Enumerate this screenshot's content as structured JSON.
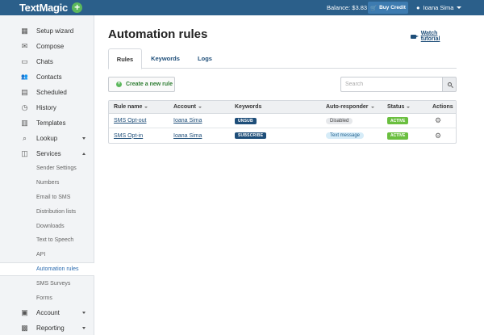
{
  "topbar": {
    "logo": "TextMagic",
    "logo_plus": "+",
    "balance": "Balance: $3.83",
    "buy_credit": "Buy Credit",
    "user_name": "Ioana Sima"
  },
  "sidebar": {
    "items": [
      {
        "label": "Setup wizard",
        "icon": "grid-icon",
        "glyph": "▦"
      },
      {
        "label": "Compose",
        "icon": "envelope-icon",
        "glyph": "✉"
      },
      {
        "label": "Chats",
        "icon": "chat-icon",
        "glyph": "▭"
      },
      {
        "label": "Contacts",
        "icon": "people-icon",
        "glyph": "👥"
      },
      {
        "label": "Scheduled",
        "icon": "calendar-icon",
        "glyph": "▤"
      },
      {
        "label": "History",
        "icon": "clock-icon",
        "glyph": "◷"
      },
      {
        "label": "Templates",
        "icon": "document-icon",
        "glyph": "▥"
      },
      {
        "label": "Lookup",
        "icon": "search-icon",
        "glyph": "⌕"
      },
      {
        "label": "Services",
        "icon": "cube-icon",
        "glyph": "◫"
      }
    ],
    "services_subitems": [
      "Sender Settings",
      "Numbers",
      "Email to SMS",
      "Distribution lists",
      "Downloads",
      "Text to Speech",
      "API",
      "Automation rules",
      "SMS Surveys",
      "Forms"
    ],
    "bottom_items": [
      {
        "label": "Account",
        "icon": "person-card-icon",
        "glyph": "▣"
      },
      {
        "label": "Reporting",
        "icon": "bar-chart-icon",
        "glyph": "▩"
      }
    ]
  },
  "main": {
    "title": "Automation rules",
    "watch_tutorial": "Watch tutorial",
    "tabs": [
      "Rules",
      "Keywords",
      "Logs"
    ],
    "create_button": "Create a new rule",
    "search_placeholder": "Search",
    "table": {
      "headers": [
        "Rule name",
        "Account",
        "Keywords",
        "Auto-responder",
        "Status",
        "Actions"
      ],
      "rows": [
        {
          "rule_name": "SMS Opt-out",
          "account": "Ioana Sima",
          "keyword": "UNSUB",
          "auto_responder": "Disabled",
          "status": "ACTIVE"
        },
        {
          "rule_name": "SMS Opt-in",
          "account": "Ioana Sima",
          "keyword": "SUBSCRIBE",
          "auto_responder": "Text message",
          "status": "ACTIVE"
        }
      ]
    }
  },
  "colors": {
    "topbar": "#2b5f8a",
    "accent_green": "#5cb85c",
    "status_green": "#6abf3f",
    "link_blue": "#1e4e79"
  }
}
